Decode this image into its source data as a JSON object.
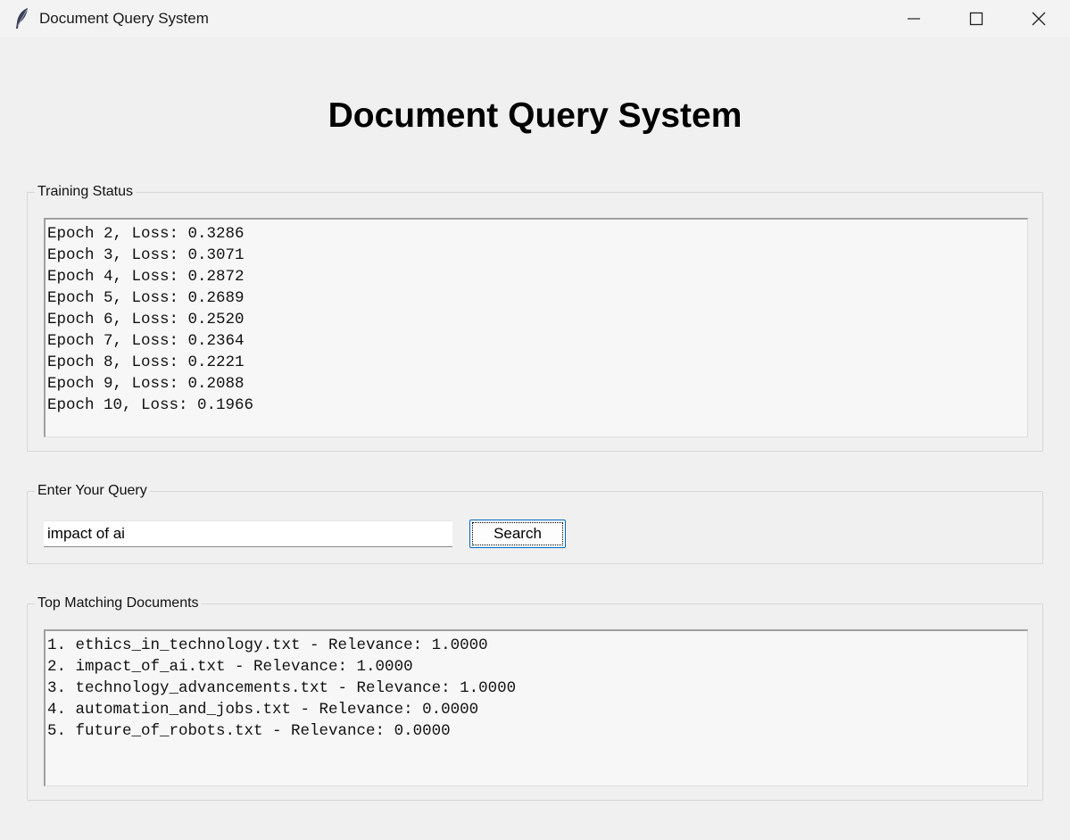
{
  "window": {
    "title": "Document Query System",
    "icon": "feather-icon"
  },
  "heading": "Document Query System",
  "training": {
    "label": "Training Status",
    "lines": [
      "Epoch 2, Loss: 0.3286",
      "Epoch 3, Loss: 0.3071",
      "Epoch 4, Loss: 0.2872",
      "Epoch 5, Loss: 0.2689",
      "Epoch 6, Loss: 0.2520",
      "Epoch 7, Loss: 0.2364",
      "Epoch 8, Loss: 0.2221",
      "Epoch 9, Loss: 0.2088",
      "Epoch 10, Loss: 0.1966"
    ]
  },
  "query": {
    "label": "Enter Your Query",
    "value": "impact of ai",
    "button": "Search"
  },
  "results": {
    "label": "Top Matching Documents",
    "lines": [
      "1. ethics_in_technology.txt - Relevance: 1.0000",
      "2. impact_of_ai.txt - Relevance: 1.0000",
      "3. technology_advancements.txt - Relevance: 1.0000",
      "4. automation_and_jobs.txt - Relevance: 0.0000",
      "5. future_of_robots.txt - Relevance: 0.0000"
    ]
  }
}
